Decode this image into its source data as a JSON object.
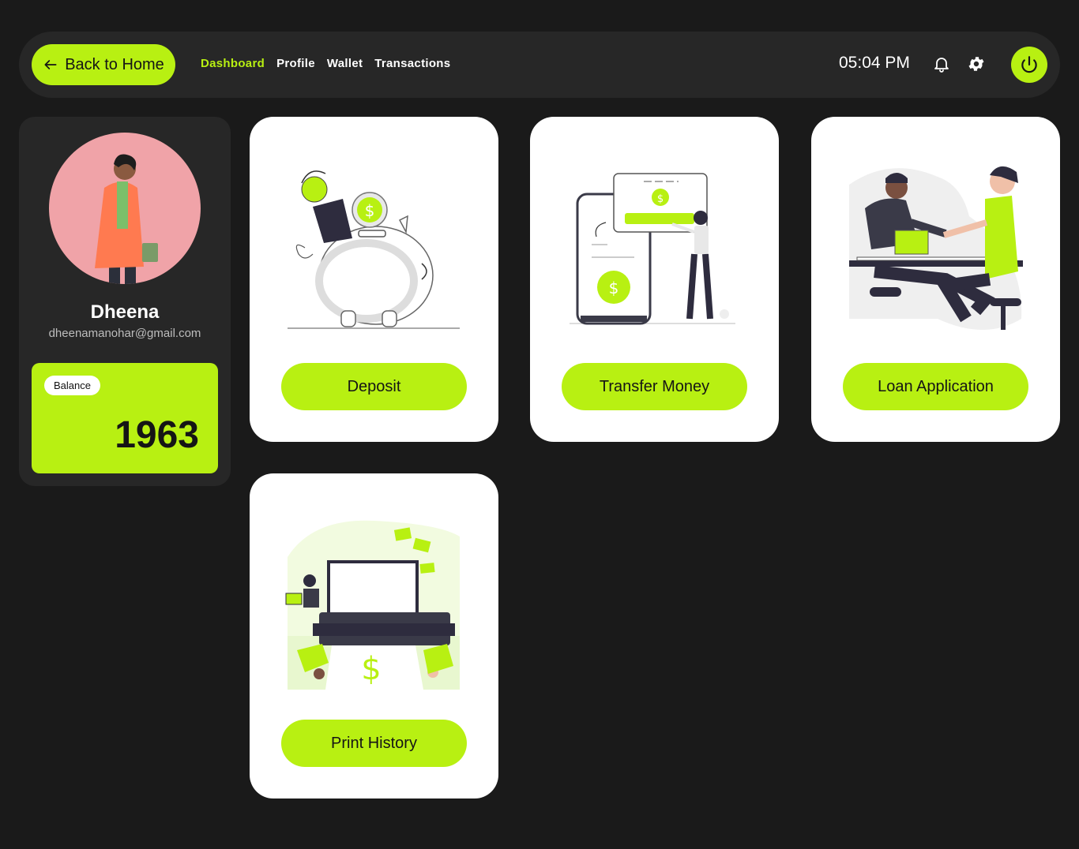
{
  "header": {
    "back_label": "Back to Home",
    "nav": [
      "Dashboard",
      "Profile",
      "Wallet",
      "Transactions"
    ],
    "active_nav": "Dashboard",
    "time": "05:04 PM",
    "icons": [
      "arrow-left-icon",
      "bell-icon",
      "gear-icon",
      "power-icon"
    ]
  },
  "profile": {
    "name": "Dheena",
    "email": "dheenamanohar@gmail.com",
    "balance_label": "Balance",
    "balance_value": "1963"
  },
  "cards": [
    {
      "label": "Deposit",
      "illustration": "piggy-bank-illustration"
    },
    {
      "label": "Transfer Money",
      "illustration": "mobile-transfer-illustration"
    },
    {
      "label": "Loan Application",
      "illustration": "handshake-illustration"
    },
    {
      "label": "Print History",
      "illustration": "printer-illustration"
    }
  ],
  "colors": {
    "accent": "#b8f012",
    "background": "#1a1a1a",
    "panel": "#272727",
    "card": "#ffffff",
    "avatar_bg": "#f0a3a8"
  }
}
